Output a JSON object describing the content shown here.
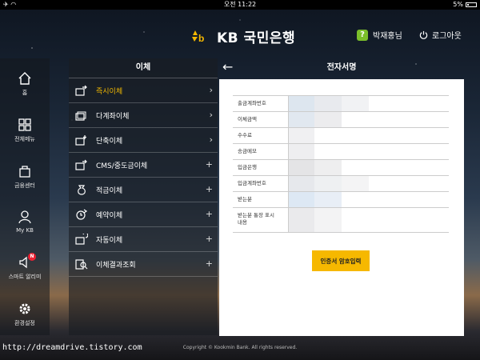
{
  "status": {
    "time": "오전 11:22",
    "battery": "5%"
  },
  "header": {
    "bank_name": "KB 국민은행",
    "user_name": "박재홍님",
    "logout_label": "로그아웃",
    "user_badge": "?"
  },
  "nav": [
    {
      "label": "홈",
      "icon": "home-icon"
    },
    {
      "label": "전체메뉴",
      "icon": "grid-icon"
    },
    {
      "label": "금융센터",
      "icon": "bag-icon"
    },
    {
      "label": "My KB",
      "icon": "person-icon"
    },
    {
      "label": "스마트 알리미",
      "icon": "speaker-icon",
      "badge": "N"
    },
    {
      "label": "환경설정",
      "icon": "gear-icon"
    }
  ],
  "transfer_menu": {
    "title": "이체",
    "items": [
      {
        "label": "즉시이체",
        "trail": "›",
        "active": true
      },
      {
        "label": "다계좌이체",
        "trail": "›"
      },
      {
        "label": "단축이체",
        "trail": "›"
      },
      {
        "label": "CMS/중도금이체",
        "trail": "+"
      },
      {
        "label": "적금이체",
        "trail": "+"
      },
      {
        "label": "예약이체",
        "trail": "+"
      },
      {
        "label": "자동이체",
        "trail": "+"
      },
      {
        "label": "이체결과조회",
        "trail": "+"
      }
    ]
  },
  "signature": {
    "title": "전자서명",
    "back_label": "←",
    "fields": [
      {
        "label": "출금계좌번호"
      },
      {
        "label": "이체금액"
      },
      {
        "label": "수수료"
      },
      {
        "label": "송금메모"
      },
      {
        "label": "입금은행"
      },
      {
        "label": "입금계좌번호"
      },
      {
        "label": "받는분"
      },
      {
        "label": "받는분 통장 표시\n내용"
      }
    ],
    "button_label": "인증서 암호입력"
  },
  "footer": {
    "copyright": "Copyright © Kookmin Bank. All rights reserved."
  },
  "watermark": "http://dreamdrive.tistory.com",
  "colors": {
    "accent": "#f6b800",
    "badge": "#e22233",
    "user_badge": "#7bbf2a"
  }
}
